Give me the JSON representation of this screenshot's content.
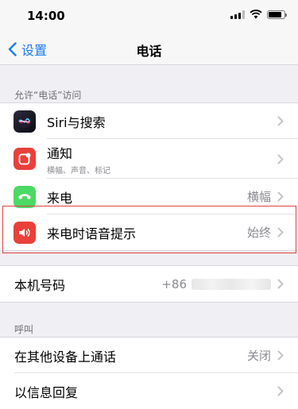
{
  "status": {
    "time": "14:00"
  },
  "nav": {
    "back_label": "设置",
    "title": "电话"
  },
  "section_access": {
    "header": "允许“电话”访问"
  },
  "access_items": [
    {
      "label": "Siri与搜索",
      "icon": "siri-icon"
    },
    {
      "label": "通知",
      "sublabel": "横幅、声音、标记",
      "icon": "notification-icon",
      "color": "#e8403a"
    },
    {
      "label": "来电",
      "value": "横幅",
      "icon": "phone-icon",
      "color": "#4cd964"
    },
    {
      "label": "来电时语音提示",
      "value": "始终",
      "icon": "speaker-icon",
      "color": "#e8403a"
    }
  ],
  "my_number": {
    "label": "本机号码",
    "value": "+86"
  },
  "section_calling": {
    "header": "呼叫"
  },
  "calling_items": [
    {
      "label": "在其他设备上通话",
      "value": "关闭"
    },
    {
      "label": "以信息回复"
    }
  ],
  "colors": {
    "accent": "#1a7cf7",
    "highlight": "#e04040"
  }
}
